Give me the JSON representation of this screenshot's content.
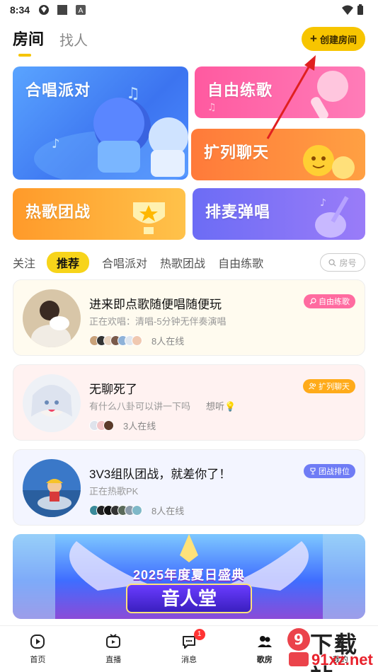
{
  "status_bar": {
    "time": "8:34"
  },
  "header": {
    "tabs": [
      {
        "label": "房间",
        "active": true
      },
      {
        "label": "找人",
        "active": false
      }
    ],
    "create_button": "创建房间"
  },
  "category_cards": [
    {
      "label": "合唱派对",
      "color": "#4d8cff"
    },
    {
      "label": "自由练歌",
      "color": "#ff5aa0"
    },
    {
      "label": "扩列聊天",
      "color": "#ff8a3a"
    },
    {
      "label": "热歌团战",
      "color": "#ffb03a"
    },
    {
      "label": "排麦弹唱",
      "color": "#8a74f7"
    }
  ],
  "filters": {
    "items": [
      "关注",
      "推荐",
      "合唱派对",
      "热歌团战",
      "自由练歌"
    ],
    "active": "推荐",
    "room_search": "房号"
  },
  "rooms": [
    {
      "title": "进来即点歌随便唱随便玩",
      "subtitle": "正在欢唱：清唱-5分钟无伴奏演唱",
      "extra": "",
      "online": "8人在线",
      "tag": "自由练歌"
    },
    {
      "title": "无聊死了",
      "subtitle": "有什么八卦可以讲一下吗",
      "extra": "想听💡",
      "online": "3人在线",
      "tag": "扩列聊天"
    },
    {
      "title": "3V3组队团战，就差你了！",
      "subtitle": "正在热歌PK",
      "extra": "",
      "online": "8人在线",
      "tag": "团战排位"
    }
  ],
  "banner": {
    "title": "2025年度夏日盛典",
    "subtitle": "音人堂"
  },
  "bottom_nav": [
    {
      "label": "首页",
      "icon": "play-circle-icon"
    },
    {
      "label": "直播",
      "icon": "tv-icon"
    },
    {
      "label": "消息",
      "icon": "chat-bubble-icon",
      "badge": "1"
    },
    {
      "label": "歌房",
      "icon": "people-icon",
      "active": true
    },
    {
      "label": "我的",
      "icon": "user-icon"
    }
  ],
  "watermark": {
    "top": "下载站",
    "bottom": "91xz.net"
  }
}
